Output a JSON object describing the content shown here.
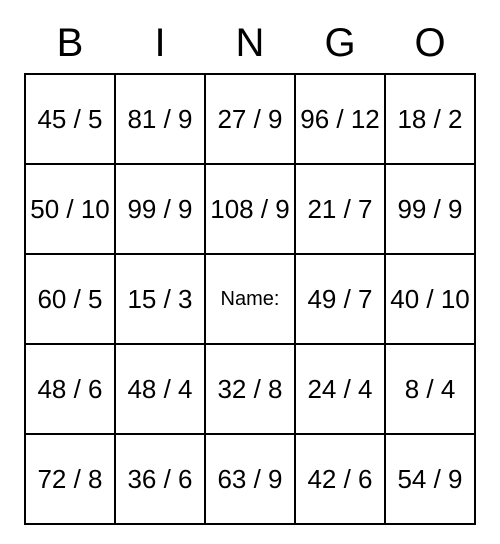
{
  "headers": [
    "B",
    "I",
    "N",
    "G",
    "O"
  ],
  "rows": [
    [
      "45 / 5",
      "81 / 9",
      "27 / 9",
      "96 / 12",
      "18 / 2"
    ],
    [
      "50 / 10",
      "99 / 9",
      "108 / 9",
      "21 / 7",
      "99 / 9"
    ],
    [
      "60 / 5",
      "15 / 3",
      "Name:",
      "49 / 7",
      "40 / 10"
    ],
    [
      "48 / 6",
      "48 / 4",
      "32 / 8",
      "24 / 4",
      "8 / 4"
    ],
    [
      "72 / 8",
      "36 / 6",
      "63 / 9",
      "42 / 6",
      "54 / 9"
    ]
  ]
}
